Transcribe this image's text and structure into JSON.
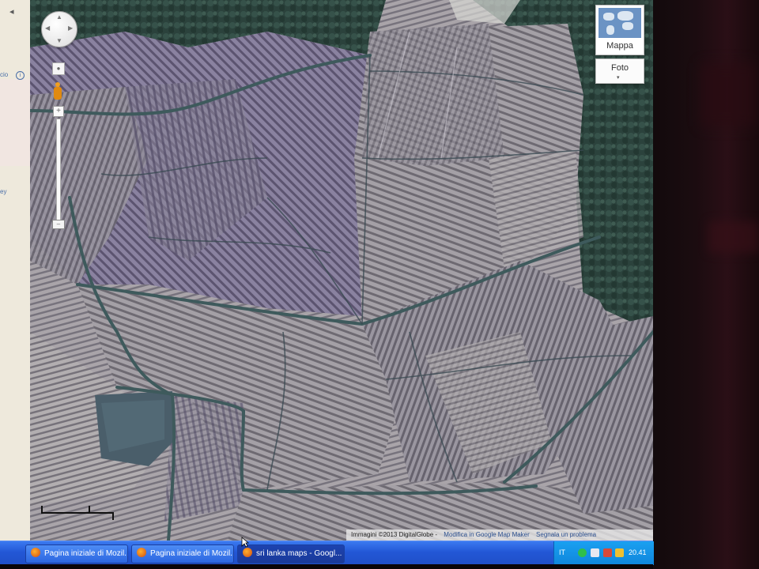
{
  "sidebar": {
    "collapse_glyph": "◂",
    "text_fragment_1": "cio",
    "info_glyph": "i",
    "text_fragment_2": "ey"
  },
  "map": {
    "view": "satellite",
    "controls": {
      "pan_arrows": [
        "▲",
        "▼",
        "◀",
        "▶"
      ],
      "zoom_in": "+",
      "zoom_out": "–",
      "zoom_level_fraction": 0.05
    },
    "map_type": {
      "primary_label": "Mappa",
      "secondary_label": "Foto",
      "secondary_caret": "▾"
    },
    "attribution": {
      "imagery": "Immagini ©2013 DigitalGlobe -",
      "edit_link": "Modifica in Google Map Maker",
      "report_link": "Segnala un problema"
    }
  },
  "taskbar": {
    "tasks": [
      {
        "label": "Pagina iniziale di Mozil...",
        "active": false
      },
      {
        "label": "Pagina iniziale di Mozil...",
        "active": false
      },
      {
        "label": "sri lanka maps - Googl...",
        "active": true
      }
    ],
    "tray": {
      "language": "IT",
      "time": "20.41"
    }
  },
  "colors": {
    "taskbar_blue": "#2357d6",
    "tray_blue": "#0f86dc",
    "satellite_forest": "#2c4a44",
    "satellite_field": "#9c989c",
    "satellite_field_violet": "#7d7596",
    "canal": "#3e5a5c"
  }
}
